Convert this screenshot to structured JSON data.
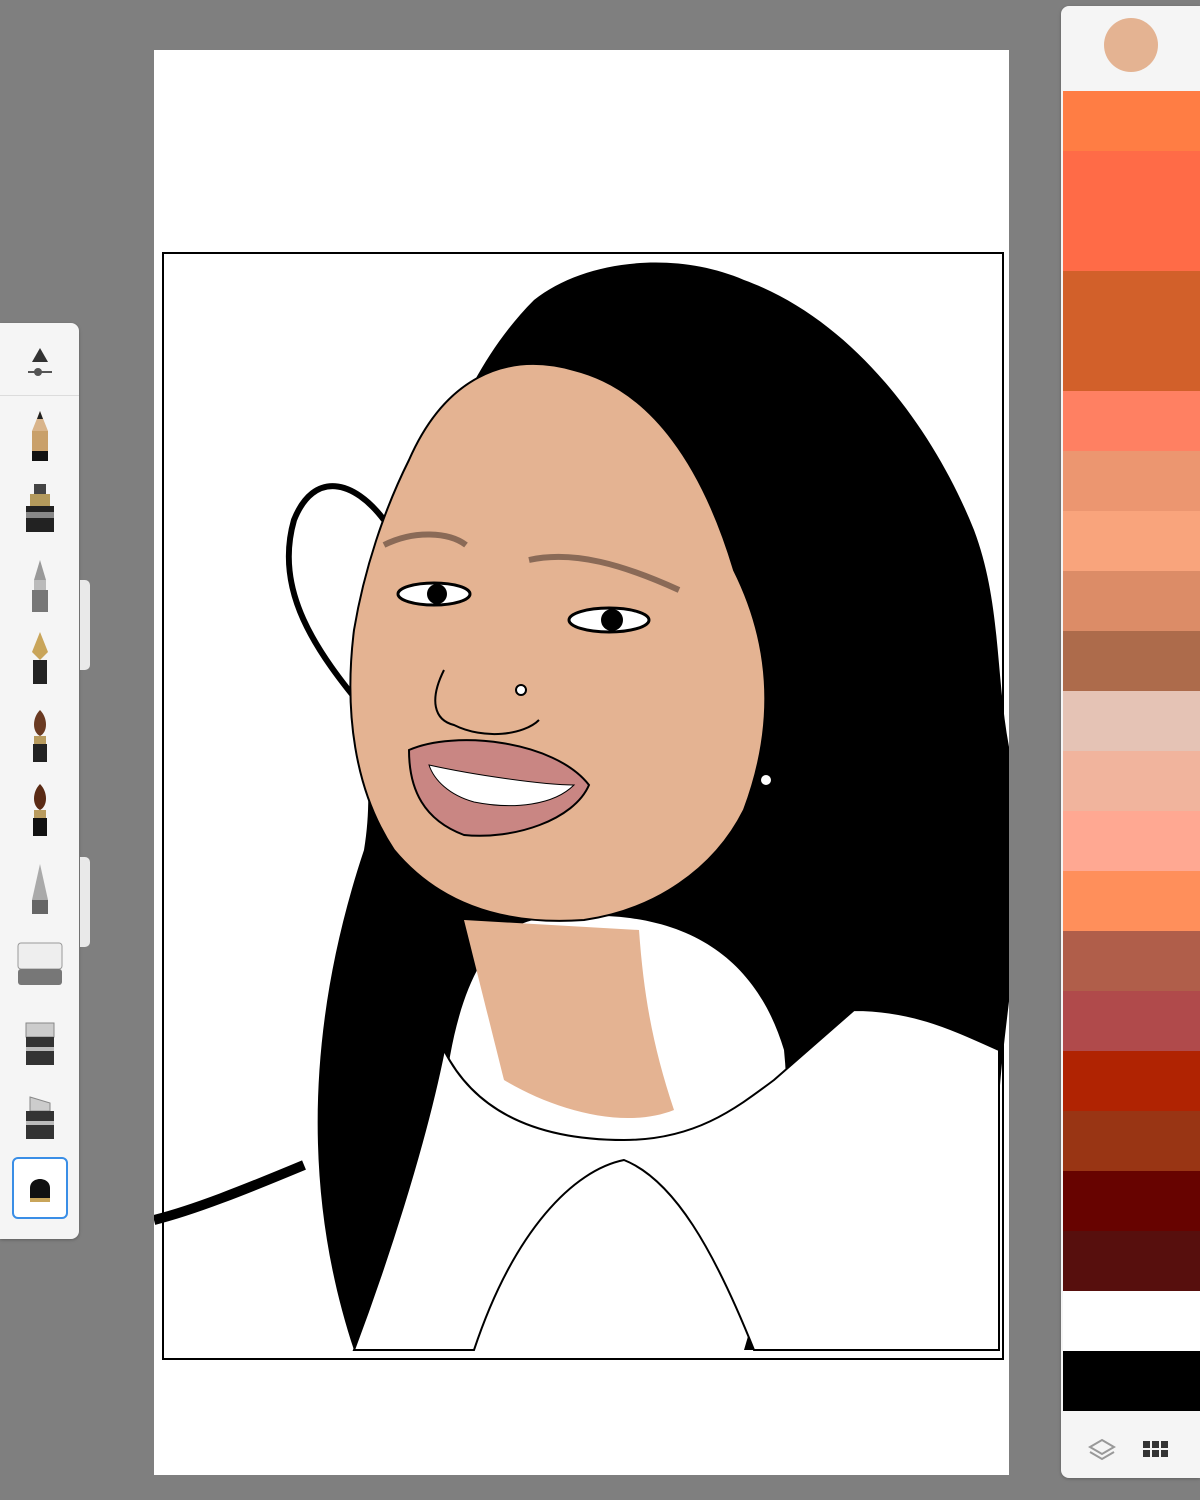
{
  "canvas": {
    "background": "#ffffff",
    "frame_color": "#000000"
  },
  "toolbar": {
    "tools": [
      {
        "name": "brush-settings-icon"
      },
      {
        "name": "pencil-icon"
      },
      {
        "name": "marker-icon"
      },
      {
        "name": "ballpoint-pen-icon"
      },
      {
        "name": "fountain-pen-icon"
      },
      {
        "name": "paint-brush-icon"
      },
      {
        "name": "ink-brush-icon"
      },
      {
        "name": "airbrush-icon"
      },
      {
        "name": "eraser-icon"
      },
      {
        "name": "smudge-icon"
      },
      {
        "name": "blender-icon"
      },
      {
        "name": "fill-icon",
        "selected": true
      }
    ]
  },
  "palette": {
    "current_color": "#e4b392",
    "swatches": [
      "#ff7d44",
      "#ff6b47",
      "#ff6b47",
      "#d2602a",
      "#d2602a",
      "#ff8062",
      "#ec9670",
      "#f9a47c",
      "#dc8c67",
      "#ad6b4b",
      "#e5c3b5",
      "#f1b49d",
      "#ffa892",
      "#ff8f5b",
      "#b05e4a",
      "#b04a4b",
      "#b02302",
      "#993514",
      "#670300",
      "#570f0d",
      "#ffffff",
      "#000000"
    ],
    "footer": {
      "layers_icon": "layers-icon",
      "grid_icon": "grid-icon"
    }
  },
  "artwork": {
    "skin": "#e4b392",
    "hair": "#000000",
    "lips": "#c98683",
    "shirt": "#ffffff"
  }
}
